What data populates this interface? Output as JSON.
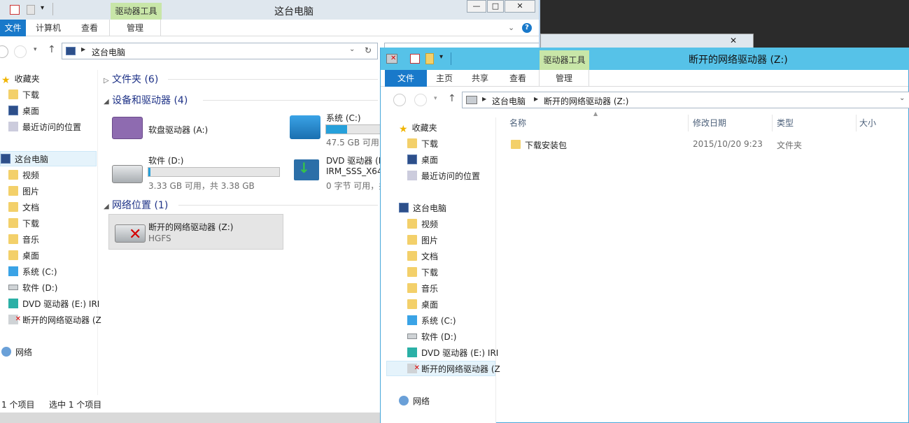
{
  "window_back": {
    "title": "这台电脑",
    "context_tab": "驱动器工具",
    "tabs": [
      "文件",
      "计算机",
      "查看",
      "管理"
    ],
    "window_buttons": [
      "—",
      "□",
      "✕"
    ],
    "address": "这台电脑",
    "nav": {
      "favorites": "收藏夹",
      "fav_items": [
        "下载",
        "桌面",
        "最近访问的位置"
      ],
      "this_pc": "这台电脑",
      "pc_items": [
        "视频",
        "图片",
        "文档",
        "下载",
        "音乐",
        "桌面",
        "系统 (C:)",
        "软件 (D:)",
        "DVD 驱动器 (E:) IRI",
        "断开的网络驱动器 (Z"
      ],
      "network": "网络"
    },
    "sections": {
      "folders": "文件夹 (6)",
      "devices": "设备和驱动器 (4)",
      "network": "网络位置 (1)"
    },
    "drives": {
      "floppy": "软盘驱动器 (A:)",
      "c_name": "系统 (C:)",
      "c_free": "47.5 GB 可用",
      "c_fill": 0.38,
      "d_name": "软件 (D:)",
      "d_free": "3.33 GB 可用，共 3.38 GB",
      "d_fill": 0.015,
      "e_name": "DVD 驱动器 (E",
      "e_label": "IRM_SSS_X64",
      "e_free": "0 字节 可用，共",
      "z_name": "断开的网络驱动器 (Z:)",
      "z_sub": "HGFS"
    },
    "status": {
      "count": "1 个项目",
      "selected": "选中 1 个项目"
    }
  },
  "window_front": {
    "title": "断开的网络驱动器 (Z:)",
    "context_tab": "驱动器工具",
    "tabs": [
      "文件",
      "主页",
      "共享",
      "查看",
      "管理"
    ],
    "breadcrumb": [
      "这台电脑",
      "断开的网络驱动器 (Z:)"
    ],
    "nav": {
      "favorites": "收藏夹",
      "fav_items": [
        "下载",
        "桌面",
        "最近访问的位置"
      ],
      "this_pc": "这台电脑",
      "pc_items": [
        "视频",
        "图片",
        "文档",
        "下载",
        "音乐",
        "桌面",
        "系统 (C:)",
        "软件 (D:)",
        "DVD 驱动器 (E:) IRI",
        "断开的网络驱动器 (Z"
      ],
      "network": "网络"
    },
    "columns": [
      "名称",
      "修改日期",
      "类型",
      "大小"
    ],
    "files": [
      {
        "name": "下载安装包",
        "date": "2015/10/20 9:23",
        "type": "文件夹"
      }
    ]
  }
}
